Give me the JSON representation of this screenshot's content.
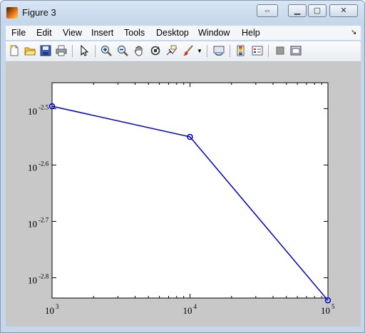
{
  "window": {
    "title": "Figure 3"
  },
  "menu": [
    "File",
    "Edit",
    "View",
    "Insert",
    "Tools",
    "Desktop",
    "Window",
    "Help"
  ],
  "toolbar_icons": [
    "new-figure-icon",
    "open-file-icon",
    "save-icon",
    "print-icon",
    "pointer-icon",
    "zoom-in-icon",
    "zoom-out-icon",
    "pan-icon",
    "rotate-3d-icon",
    "data-cursor-icon",
    "brush-icon",
    "link-plot-icon",
    "colorbar-icon",
    "legend-icon",
    "hide-plot-tools-icon",
    "show-plot-tools-icon"
  ],
  "chart_data": {
    "type": "line",
    "x_scale": "log",
    "y_scale": "log",
    "x": [
      1000,
      10000,
      100000
    ],
    "y": [
      0.003193,
      0.002818,
      0.001445
    ],
    "xlim": [
      1000,
      100000
    ],
    "ylim_exponents": [
      -2.836,
      -2.454
    ],
    "x_ticks": [
      {
        "base": "10",
        "exp": "3"
      },
      {
        "base": "10",
        "exp": "4"
      },
      {
        "base": "10",
        "exp": "5"
      }
    ],
    "y_ticks": [
      {
        "base": "10",
        "exp": "-2.5",
        "value": -2.5
      },
      {
        "base": "10",
        "exp": "-2.6",
        "value": -2.6
      },
      {
        "base": "10",
        "exp": "-2.7",
        "value": -2.7
      },
      {
        "base": "10",
        "exp": "-2.8",
        "value": -2.8
      }
    ],
    "line_color": "#0000cc",
    "marker": "circle"
  }
}
